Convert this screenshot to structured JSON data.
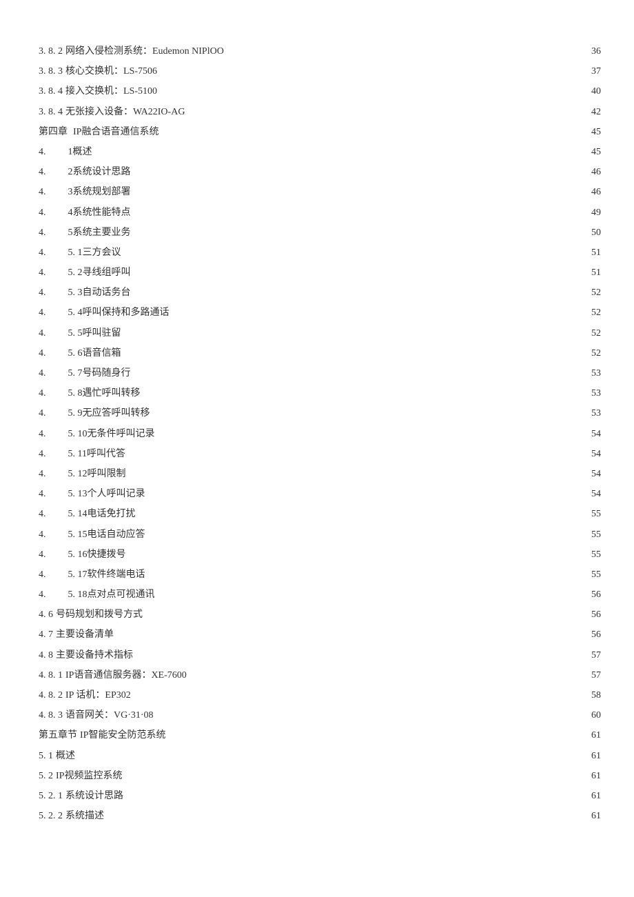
{
  "toc": [
    {
      "num": "3. 8. 2",
      "title": "网络入侵检测系统：Eudemon NIPlOO ",
      "page": "36",
      "indent": 0,
      "leader": "tight"
    },
    {
      "num": "3. 8. 3 ",
      "title": "核心交换机：LS-7506 ",
      "page": "37",
      "indent": 0,
      "leader": "tight"
    },
    {
      "num": "3. 8. 4 ",
      "title": "接入交换机：LS-5100 ",
      "page": "40",
      "indent": 0,
      "leader": "tight"
    },
    {
      "num": "3. 8. 4",
      "title": "无张接入设备：WA22IO-AG ",
      "page": "42",
      "indent": 0,
      "leader": "tight"
    },
    {
      "num": "第四章",
      "title": "IP融合语音通信系统 ",
      "page": " 45",
      "indent": 4,
      "leader": "loose"
    },
    {
      "num": "4.",
      "title": "1概述 ",
      "page": " 45",
      "indent": 28,
      "leader": "loose"
    },
    {
      "num": "4.",
      "title": "2系统设计思路 ",
      "page": " 46",
      "indent": 28,
      "leader": "loose"
    },
    {
      "num": "4.",
      "title": "3系统规划部署 ",
      "page": " 46",
      "indent": 28,
      "leader": "loose"
    },
    {
      "num": "4.",
      "title": "4系统性能特点 ",
      "page": " 49",
      "indent": 28,
      "leader": "loose"
    },
    {
      "num": "4.",
      "title": "5系统主要业务 ",
      "page": " 50",
      "indent": 28,
      "leader": "loose"
    },
    {
      "num": "4.",
      "title": "5. 1三方会议 ",
      "page": " 51",
      "indent": 28,
      "leader": "loose"
    },
    {
      "num": "4.",
      "title": "5. 2寻线组呼叫 ",
      "page": " 51",
      "indent": 28,
      "leader": "loose"
    },
    {
      "num": "4.",
      "title": "5. 3自动话务台 ",
      "page": " 52",
      "indent": 28,
      "leader": "loose"
    },
    {
      "num": "4.",
      "title": "5. 4呼叫保持和多路通话 ",
      "page": " 52",
      "indent": 28,
      "leader": "loose"
    },
    {
      "num": "4.",
      "title": "5. 5呼叫驻留 ",
      "page": " 52",
      "indent": 28,
      "leader": "loose"
    },
    {
      "num": "4.",
      "title": "5. 6语音信箱 ",
      "page": " 52",
      "indent": 28,
      "leader": "loose"
    },
    {
      "num": "4.",
      "title": "5. 7号码随身行 ",
      "page": " 53",
      "indent": 28,
      "leader": "loose"
    },
    {
      "num": "4.",
      "title": "5. 8遇忙呼叫转移 ",
      "page": " 53",
      "indent": 28,
      "leader": "loose"
    },
    {
      "num": "4.",
      "title": "5. 9无应答呼叫转移 ",
      "page": " 53",
      "indent": 28,
      "leader": "loose"
    },
    {
      "num": "4.",
      "title": "5. 10无条件呼叫记录 ",
      "page": " 54",
      "indent": 28,
      "leader": "loose"
    },
    {
      "num": "4.",
      "title": "5. 11呼叫代答 ",
      "page": " 54",
      "indent": 28,
      "leader": "loose"
    },
    {
      "num": "4.",
      "title": "5. 12呼叫限制 ",
      "page": " 54",
      "indent": 28,
      "leader": "loose"
    },
    {
      "num": "4.",
      "title": "5. 13个人呼叫记录 ",
      "page": " 54",
      "indent": 28,
      "leader": "loose"
    },
    {
      "num": "4.",
      "title": "5. 14电话免打扰 ",
      "page": " 55",
      "indent": 28,
      "leader": "loose"
    },
    {
      "num": "4.",
      "title": "5. 15电话自动应答 ",
      "page": " 55",
      "indent": 28,
      "leader": "loose"
    },
    {
      "num": "4.",
      "title": "5. 16快捷拨号 ",
      "page": " 55",
      "indent": 28,
      "leader": "loose"
    },
    {
      "num": "4.",
      "title": "5. 17软件终端电话 ",
      "page": " 55",
      "indent": 28,
      "leader": "loose"
    },
    {
      "num": "4.",
      "title": "5. 18点对点可视通讯 ",
      "page": " 56",
      "indent": 28,
      "leader": "loose"
    },
    {
      "num": "4. 6",
      "title": "号码规划和拨号方式 ",
      "page": " 56",
      "indent": 0,
      "leader": "loose"
    },
    {
      "num": "4. 7",
      "title": "主要设备清单 ",
      "page": " 56",
      "indent": 0,
      "leader": "loose"
    },
    {
      "num": "4. 8",
      "title": "主要设备持术指标 ",
      "page": " 57",
      "indent": 0,
      "leader": "loose"
    },
    {
      "num": "4. 8. 1",
      "title": "IP语音通信服务器：XE-7600 ",
      "page": "57",
      "indent": 0,
      "leader": "tight"
    },
    {
      "num": "4. 8. 2 ",
      "title": "IP 话机：EP302 ",
      "page": "58",
      "indent": 0,
      "leader": "tight"
    },
    {
      "num": "4. 8. 3 ",
      "title": "语音网关：VG·31·08 ",
      "page": "60",
      "indent": 0,
      "leader": "tight"
    },
    {
      "num": "第五章节",
      "title": "IP智能安全防范系统 ",
      "page": " 61",
      "indent": 0,
      "leader": "loose"
    },
    {
      "num": "5. 1",
      "title": "概述 ",
      "page": " 61",
      "indent": 0,
      "leader": "loose"
    },
    {
      "num": "5. 2 ",
      "title": "IP视频监控系统 ",
      "page": " 61",
      "indent": 0,
      "leader": "loose"
    },
    {
      "num": "5. 2. 1",
      "title": "系统设计思路 ",
      "page": " 61",
      "indent": 0,
      "leader": "loose"
    },
    {
      "num": "5. 2. 2",
      "title": "系统描述 ",
      "page": " 61",
      "indent": 0,
      "leader": "loose"
    }
  ]
}
